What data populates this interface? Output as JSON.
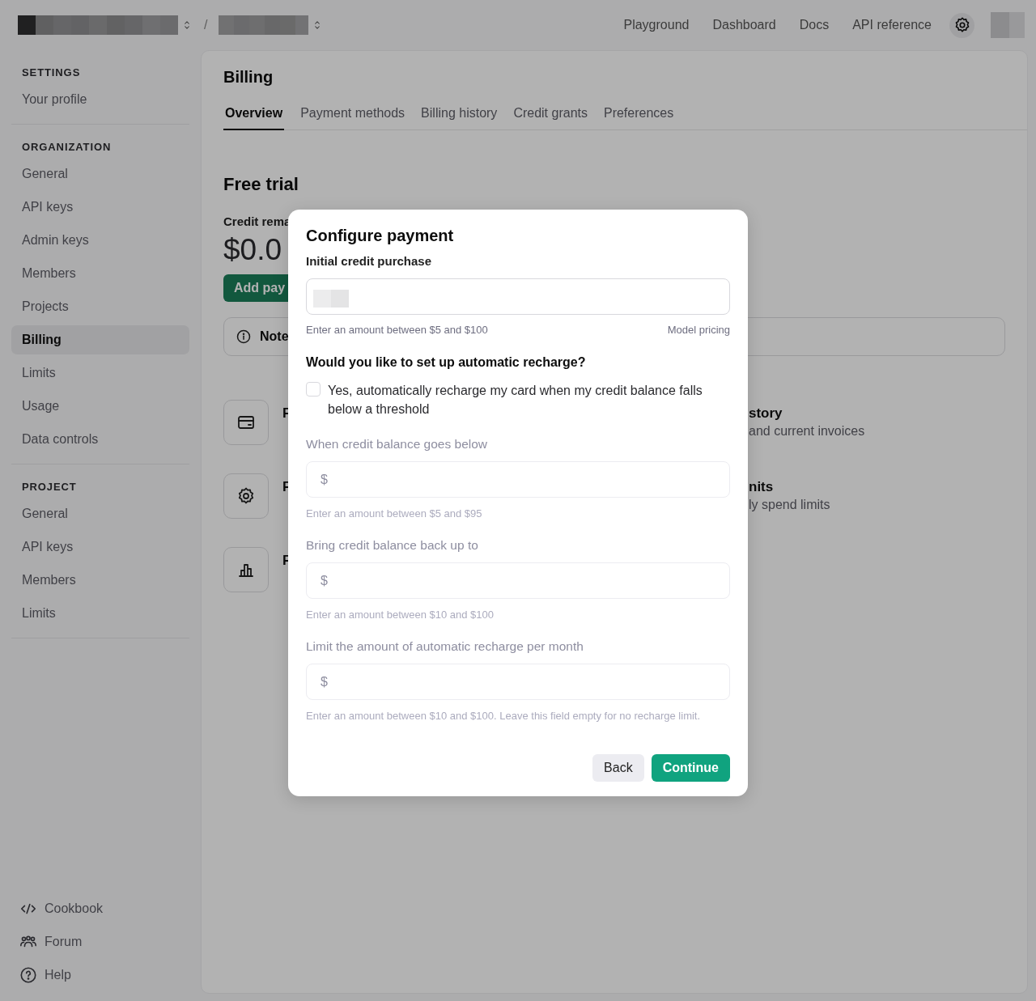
{
  "topbar": {
    "separator": "/",
    "nav": [
      "Playground",
      "Dashboard",
      "Docs",
      "API reference"
    ]
  },
  "sidebar": {
    "sections": [
      {
        "heading": "SETTINGS",
        "items": [
          {
            "label": "Your profile",
            "selected": false
          }
        ]
      },
      {
        "heading": "ORGANIZATION",
        "items": [
          {
            "label": "General",
            "selected": false
          },
          {
            "label": "API keys",
            "selected": false
          },
          {
            "label": "Admin keys",
            "selected": false
          },
          {
            "label": "Members",
            "selected": false
          },
          {
            "label": "Projects",
            "selected": false
          },
          {
            "label": "Billing",
            "selected": true
          },
          {
            "label": "Limits",
            "selected": false
          },
          {
            "label": "Usage",
            "selected": false
          },
          {
            "label": "Data controls",
            "selected": false
          }
        ]
      },
      {
        "heading": "PROJECT",
        "items": [
          {
            "label": "General",
            "selected": false
          },
          {
            "label": "API keys",
            "selected": false
          },
          {
            "label": "Members",
            "selected": false
          },
          {
            "label": "Limits",
            "selected": false
          }
        ]
      }
    ],
    "footer": [
      {
        "label": "Cookbook",
        "kind": "code"
      },
      {
        "label": "Forum",
        "kind": "people"
      },
      {
        "label": "Help",
        "kind": "help"
      }
    ]
  },
  "billing": {
    "title": "Billing",
    "tabs": [
      {
        "label": "Overview",
        "selected": true
      },
      {
        "label": "Payment methods",
        "selected": false
      },
      {
        "label": "Billing history",
        "selected": false
      },
      {
        "label": "Credit grants",
        "selected": false
      },
      {
        "label": "Preferences",
        "selected": false
      }
    ],
    "section_title": "Free trial",
    "credit_label": "Credit rema",
    "credit_amount": "$0.0",
    "add_button": "Add pay",
    "note": "Note",
    "cards": [
      {
        "kind": "card",
        "title": "F",
        "right_title": "story",
        "right_subtitle": "and current invoices"
      },
      {
        "kind": "gear",
        "title": "F",
        "right_title": "nits",
        "right_subtitle": "ly spend limits"
      },
      {
        "kind": "chart",
        "title": "F"
      }
    ]
  },
  "modal": {
    "title": "Configure payment",
    "initial": {
      "label": "Initial credit purchase",
      "hint": "Enter an amount between $5 and $100",
      "link": "Model pricing"
    },
    "question": "Would you like to set up automatic recharge?",
    "checkbox": {
      "label": "Yes, automatically recharge my card when my credit balance falls below a threshold",
      "checked": false
    },
    "fields": [
      {
        "label": "When credit balance goes below",
        "placeholder": "$",
        "hint": "Enter an amount between $5 and $95",
        "disabled": true
      },
      {
        "label": "Bring credit balance back up to",
        "placeholder": "$",
        "hint": "Enter an amount between $10 and $100",
        "disabled": true
      },
      {
        "label": "Limit the amount of automatic recharge per month",
        "placeholder": "$",
        "hint": "Enter an amount between $10 and $100. Leave this field empty for no recharge limit.",
        "disabled": true
      }
    ],
    "buttons": [
      {
        "label": "Back",
        "kind": "secondary"
      },
      {
        "label": "Continue",
        "kind": "primary"
      }
    ]
  }
}
